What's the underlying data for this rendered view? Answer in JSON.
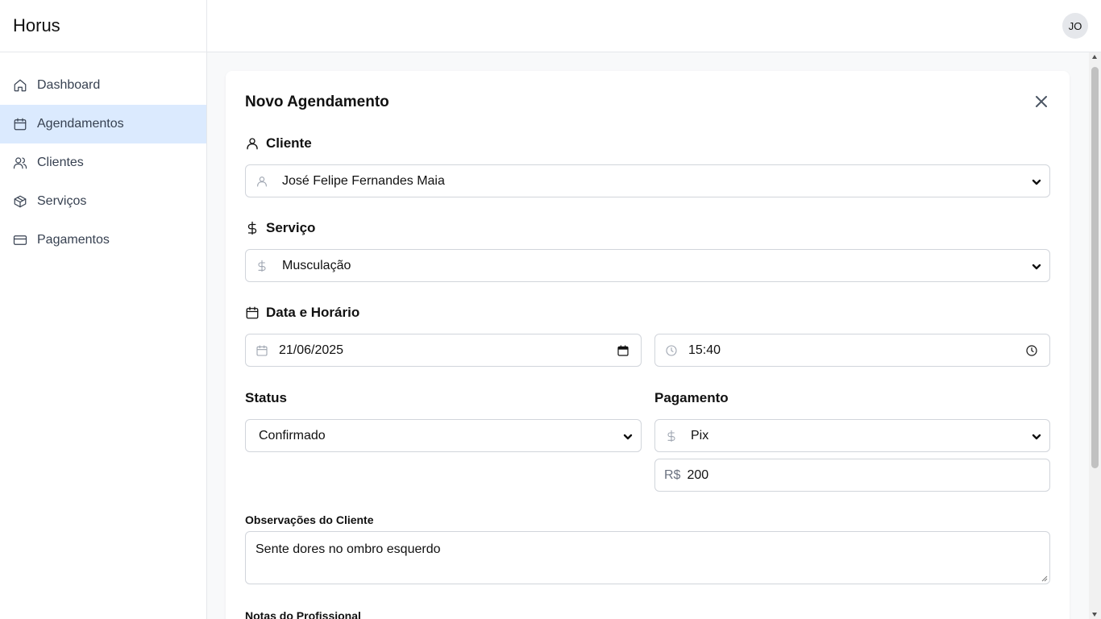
{
  "app": {
    "brand": "Horus"
  },
  "sidebar": {
    "items": [
      {
        "label": "Dashboard",
        "icon": "home-icon"
      },
      {
        "label": "Agendamentos",
        "icon": "calendar-icon",
        "active": true
      },
      {
        "label": "Clientes",
        "icon": "users-icon"
      },
      {
        "label": "Serviços",
        "icon": "package-icon"
      },
      {
        "label": "Pagamentos",
        "icon": "credit-card-icon"
      }
    ]
  },
  "topbar": {
    "avatar_initials": "JO"
  },
  "form": {
    "title": "Novo Agendamento",
    "cliente": {
      "label": "Cliente",
      "value": "José Felipe Fernandes Maia"
    },
    "servico": {
      "label": "Serviço",
      "value": "Musculação"
    },
    "data_horario": {
      "label": "Data e Horário",
      "date": "21/06/2025",
      "time": "15:40"
    },
    "status": {
      "label": "Status",
      "value": "Confirmado"
    },
    "pagamento": {
      "label": "Pagamento",
      "method": "Pix",
      "currency": "R$",
      "amount": "200"
    },
    "observacoes": {
      "label": "Observações do Cliente",
      "value": "Sente dores no ombro esquerdo"
    },
    "notas": {
      "label": "Notas do Profissional"
    }
  },
  "colors": {
    "active_nav_bg": "#dbeafe",
    "border": "#d1d5db",
    "page_bg": "#f8f9fa"
  }
}
